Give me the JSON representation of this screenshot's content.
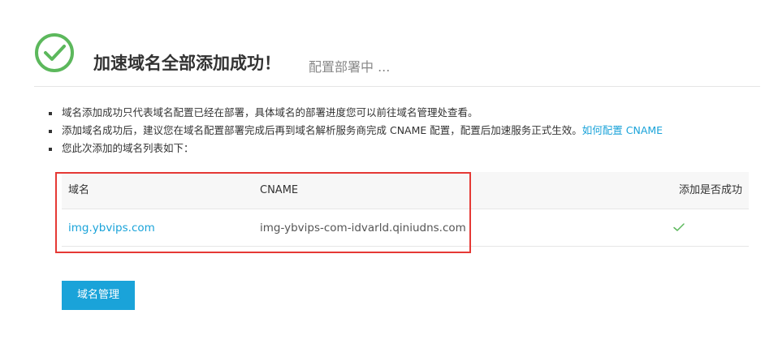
{
  "header": {
    "title": "加速域名全部添加成功！",
    "subtitle": "配置部署中 ...",
    "icon": "success-check-circle-icon",
    "accent_color": "#5cb85c"
  },
  "notes": {
    "items": [
      {
        "text": "域名添加成功只代表域名配置已经在部署，具体域名的部署进度您可以前往域名管理处查看。"
      },
      {
        "text": "添加域名成功后，建议您在域名配置部署完成后再到域名解析服务商完成 CNAME 配置，配置后加速服务正式生效。",
        "link": "如何配置 CNAME"
      },
      {
        "text": "您此次添加的域名列表如下："
      }
    ]
  },
  "table": {
    "columns": [
      "域名",
      "CNAME",
      "添加是否成功"
    ],
    "rows": [
      {
        "domain": "img.ybvips.com",
        "cname": "img-ybvips-com-idvarld.qiniudns.com",
        "success_icon": "check-icon"
      }
    ]
  },
  "actions": {
    "manage_label": "域名管理",
    "button_color": "#1aa3d9"
  }
}
